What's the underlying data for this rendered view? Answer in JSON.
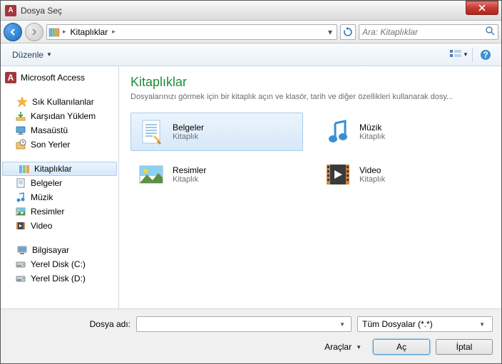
{
  "titlebar": {
    "title": "Dosya Seç"
  },
  "breadcrumb": {
    "current": "Kitaplıklar"
  },
  "search": {
    "placeholder": "Ara: Kitaplıklar"
  },
  "toolbar": {
    "organize": "Düzenle"
  },
  "sidebar": {
    "access": "Microsoft Access",
    "favorites": {
      "header": "Sık Kullanılanlar",
      "downloads": "Karşıdan Yüklem",
      "desktop": "Masaüstü",
      "recent": "Son Yerler"
    },
    "libraries": {
      "header": "Kitaplıklar",
      "documents": "Belgeler",
      "music": "Müzik",
      "pictures": "Resimler",
      "videos": "Video"
    },
    "computer": {
      "header": "Bilgisayar",
      "diskC": "Yerel Disk (C:)",
      "diskD": "Yerel Disk (D:)"
    }
  },
  "content": {
    "title": "Kitaplıklar",
    "description": "Dosyalarınızı görmek için bir kitaplık açın ve klasör, tarih ve diğer özellikleri kullanarak dosy...",
    "sublabel": "Kitaplık",
    "items": {
      "documents": "Belgeler",
      "music": "Müzik",
      "pictures": "Resimler",
      "videos": "Video"
    }
  },
  "footer": {
    "filename_label": "Dosya adı:",
    "filter": "Tüm Dosyalar (*.*)",
    "tools": "Araçlar",
    "open": "Aç",
    "cancel": "İptal"
  }
}
